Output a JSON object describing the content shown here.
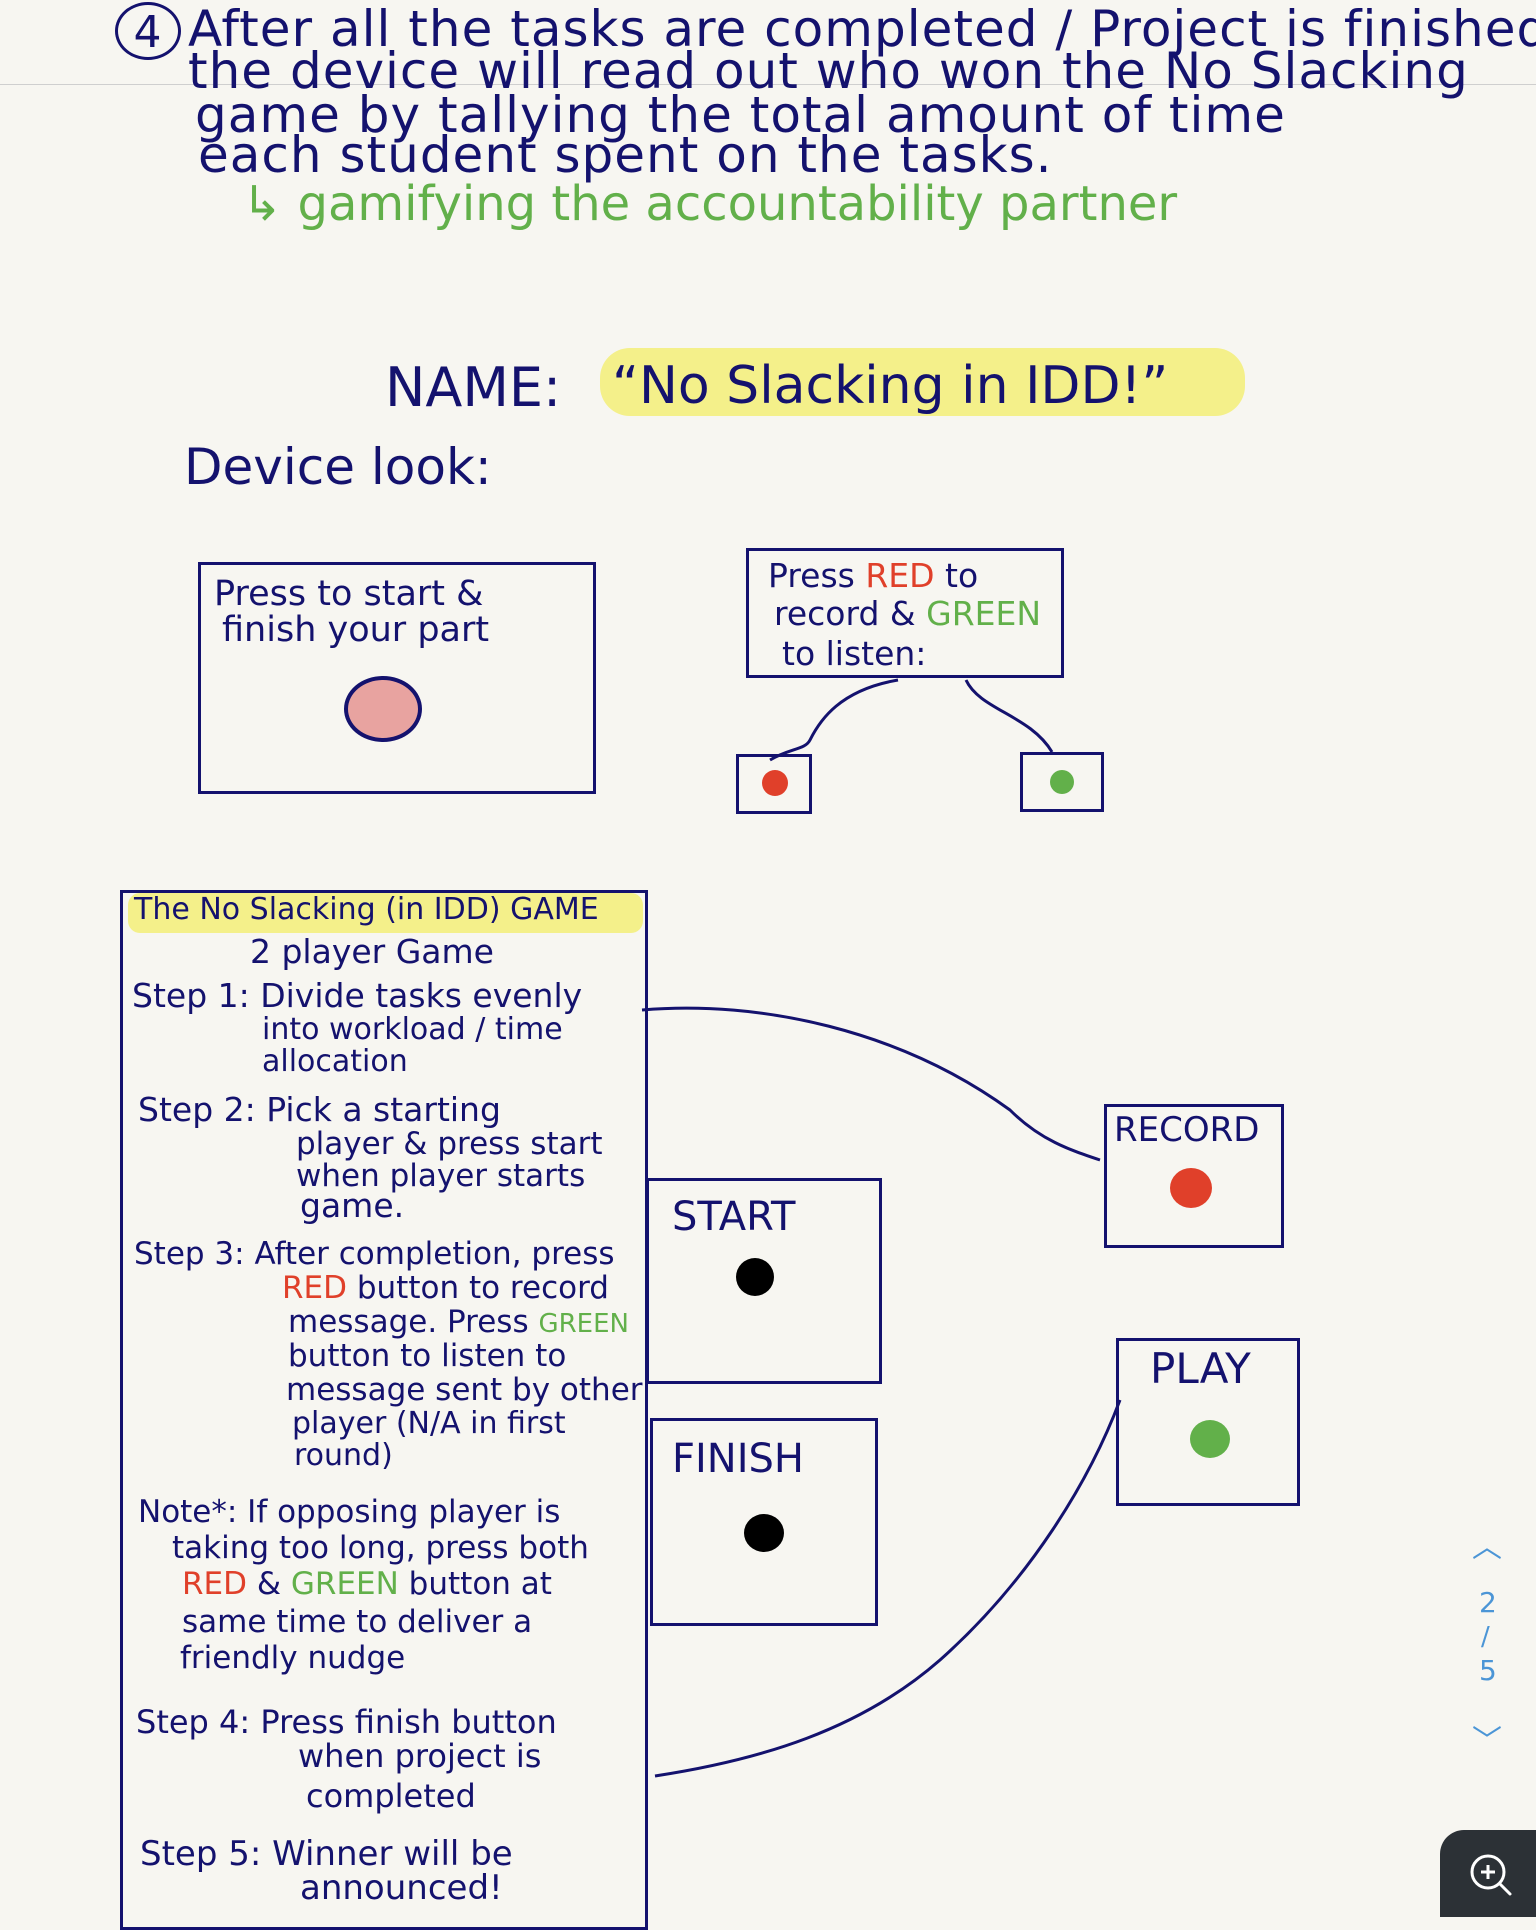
{
  "intro": {
    "number": "4",
    "lines": [
      "After all the tasks are completed / Project is finished,",
      "the device will read out who won the No Slacking",
      "game by tallying the total amount of time",
      "each student spent on the tasks."
    ],
    "note": "↳ gamifying the accountability partner"
  },
  "name": {
    "label": "NAME:",
    "value": "“No Slacking in IDD!”"
  },
  "device_look": {
    "label": "Device look:"
  },
  "sketch_left": {
    "line1": "Press to start &",
    "line2": "finish your part"
  },
  "sketch_right": {
    "w1": "Press ",
    "w_red": "RED",
    "w2": " to",
    "w3": "record & ",
    "w_green": "GREEN",
    "w4": "to listen:"
  },
  "instructions": {
    "title": "The No Slacking (in IDD) GAME",
    "subtitle": "2 player Game",
    "step1": [
      "Step 1: Divide tasks evenly",
      "into workload / time",
      "allocation"
    ],
    "step2": [
      "Step 2: Pick a starting",
      "player & press start",
      "when player starts",
      "game."
    ],
    "step3_l1": "Step 3: After completion, press",
    "step3_red": "RED",
    "step3_l2": " button to record",
    "step3_l3": "message. Press ",
    "step3_green": "GREEN",
    "step3_l4": "button to listen to",
    "step3_l5": "message sent by other",
    "step3_l6": "player (N/A in first",
    "step3_l7": "round)",
    "note_l1": "Note*: If opposing player is",
    "note_l2": "taking too long, press both",
    "note_red": "RED",
    "note_amp": " & ",
    "note_green": "GREEN",
    "note_l3": " button at",
    "note_l4": "same time to deliver a",
    "note_l5": "friendly nudge",
    "step4": [
      "Step 4: Press finish button",
      "when project is",
      "completed"
    ],
    "step5": [
      "Step 5: Winner will be",
      "announced!"
    ]
  },
  "buttons": {
    "start": "START",
    "finish": "FINISH",
    "record": "RECORD",
    "play": "PLAY"
  },
  "pager": {
    "current": "2",
    "sep": "/",
    "total": "5"
  },
  "colors": {
    "ink": "#14126e",
    "red": "#e0402a",
    "green": "#62b04a",
    "highlight": "#f4f08a",
    "pink_button": "#e8a3a0",
    "accent_nav": "#4b95d6"
  }
}
